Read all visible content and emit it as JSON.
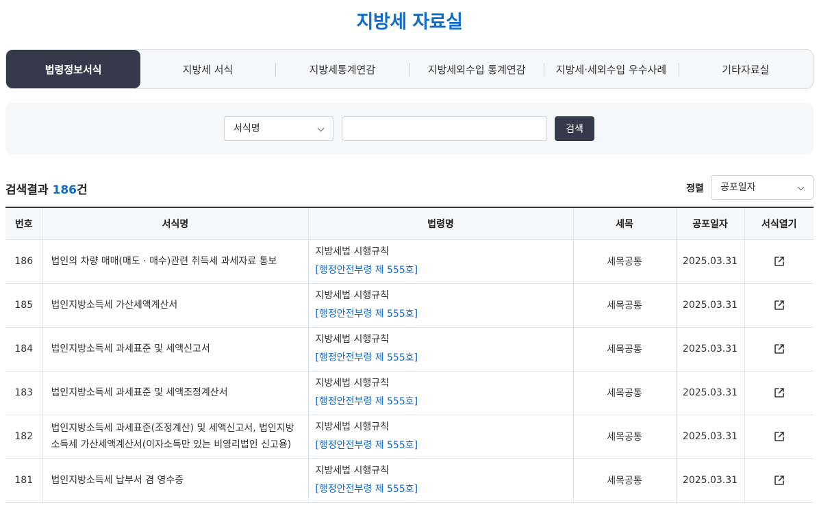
{
  "page": {
    "title": "지방세 자료실"
  },
  "tabs": [
    {
      "label": "법령정보서식",
      "active": true
    },
    {
      "label": "지방세 서식",
      "active": false
    },
    {
      "label": "지방세통계연감",
      "active": false
    },
    {
      "label": "지방세외수입 통계연감",
      "active": false
    },
    {
      "label": "지방세·세외수입 우수사례",
      "active": false
    },
    {
      "label": "기타자료실",
      "active": false
    }
  ],
  "search": {
    "field_value": "서식명",
    "query": "",
    "button_label": "검색"
  },
  "results": {
    "prefix": "검색결과 ",
    "count": "186",
    "suffix": "건"
  },
  "sort": {
    "label": "정렬",
    "value": "공포일자"
  },
  "table": {
    "headers": {
      "no": "번호",
      "name": "서식명",
      "law": "법령명",
      "tax": "세목",
      "date": "공포일자",
      "open": "서식열기"
    },
    "rows": [
      {
        "no": "186",
        "name": "법인의 차량 매매(매도 · 매수)관련 취득세 과세자료 통보",
        "law": "지방세법 시행규칙",
        "law_ref": "[행정안전부령 제 555호]",
        "tax": "세목공통",
        "date": "2025.03.31"
      },
      {
        "no": "185",
        "name": "법인지방소득세 가산세액계산서",
        "law": "지방세법 시행규칙",
        "law_ref": "[행정안전부령 제 555호]",
        "tax": "세목공통",
        "date": "2025.03.31"
      },
      {
        "no": "184",
        "name": "법인지방소득세 과세표준 및 세액신고서",
        "law": "지방세법 시행규칙",
        "law_ref": "[행정안전부령 제 555호]",
        "tax": "세목공통",
        "date": "2025.03.31"
      },
      {
        "no": "183",
        "name": "법인지방소득세 과세표준 및 세액조정계산서",
        "law": "지방세법 시행규칙",
        "law_ref": "[행정안전부령 제 555호]",
        "tax": "세목공통",
        "date": "2025.03.31"
      },
      {
        "no": "182",
        "name": "법인지방소득세 과세표준(조정계산) 및 세액신고서, 법인지방소득세 가산세액계산서(이자소득만 있는 비영리법인 신고용)",
        "law": "지방세법 시행규칙",
        "law_ref": "[행정안전부령 제 555호]",
        "tax": "세목공통",
        "date": "2025.03.31"
      },
      {
        "no": "181",
        "name": "법인지방소득세 납부서 겸 영수증",
        "law": "지방세법 시행규칙",
        "law_ref": "[행정안전부령 제 555호]",
        "tax": "세목공통",
        "date": "2025.03.31"
      }
    ]
  },
  "icons": {
    "open": "external-link-icon",
    "select": "chevron-down-icon"
  },
  "colors": {
    "accent": "#0f6cc8",
    "dark": "#353a4a"
  }
}
